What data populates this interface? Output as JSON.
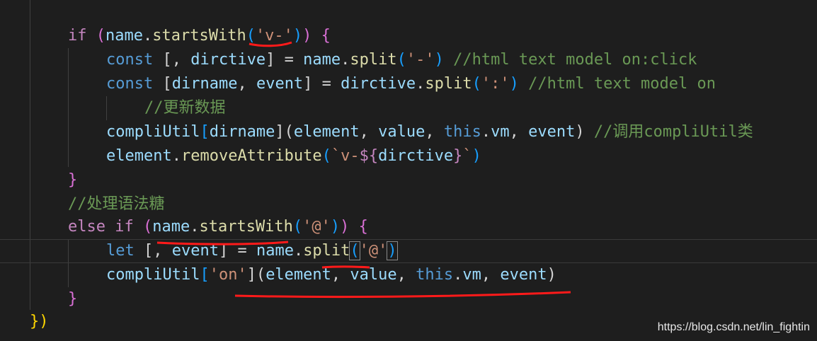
{
  "code": {
    "l1": {
      "kw": "if",
      "sp": " ",
      "open": "(",
      "obj": "name",
      ".": ".",
      "fn": "startsWith",
      "po": "(",
      "str": "'v-'",
      "pc": ")",
      "close": ")",
      "sp2": " ",
      "brace": "{"
    },
    "l2": {
      "k": "const",
      "a": " [, ",
      "v": "dirctive",
      "b": "] = ",
      "obj": "name",
      ".": ".",
      "fn": "split",
      "po": "(",
      "str": "'-'",
      "pc": ")",
      "cm": " //html text model on:click"
    },
    "l3": {
      "k": "const",
      "a": " [",
      "v1": "dirname",
      "c": ", ",
      "v2": "event",
      "b": "] = ",
      "obj": "dirctive",
      ".": ".",
      "fn": "split",
      "po": "(",
      "str": "':'",
      "pc": ")",
      "cm": " //html text model on"
    },
    "l4": {
      "cm": "//更新数据"
    },
    "l5": {
      "obj": "compliUtil",
      "o": "[",
      "v": "dirname",
      "c": "](",
      "v2": "element",
      "c2": ", ",
      "v3": "value",
      "c3": ", ",
      "t": "this",
      "d": ".",
      "v4": "vm",
      "c4": ", ",
      "v5": "event",
      "e": ")",
      "cm": " //调用compliUtil类"
    },
    "l6": {
      "obj": "element",
      ".": ".",
      "fn": "removeAttribute",
      "po": "(",
      "s1": "`v-",
      "d1": "${",
      "v": "dirctive",
      "d2": "}",
      "s2": "`",
      "pc": ")"
    },
    "l7": {
      "brace": "}"
    },
    "l8": {
      "cm": "//处理语法糖"
    },
    "l9": {
      "kw1": "else",
      "kw2": " if",
      "sp": " ",
      "open": "(",
      "obj": "name",
      ".": ".",
      "fn": "startsWith",
      "po": "(",
      "str": "'@'",
      "pc": ")",
      "close": ")",
      "sp2": " ",
      "brace": "{"
    },
    "l10": {
      "k": "let",
      "a": " [, ",
      "v": "event",
      "b": "] = ",
      "obj": "name",
      ".": ".",
      "fn": "split",
      "po": "(",
      "str": "'@'",
      "pc": ")"
    },
    "l11": {
      "obj": "compliUtil",
      "o": "[",
      "str": "'on'",
      "c": "](",
      "v2": "element",
      "c2": ", ",
      "v3": "value",
      "c3": ", ",
      "t": "this",
      "d": ".",
      "v4": "vm",
      "c4": ", ",
      "v5": "event",
      "e": ")"
    },
    "l12": {
      "brace": "}"
    },
    "l13": {
      "b": "}",
      ")": ")"
    }
  },
  "watermark": "https://blog.csdn.net/lin_fightin",
  "annotation_color": "#ff1a1a"
}
